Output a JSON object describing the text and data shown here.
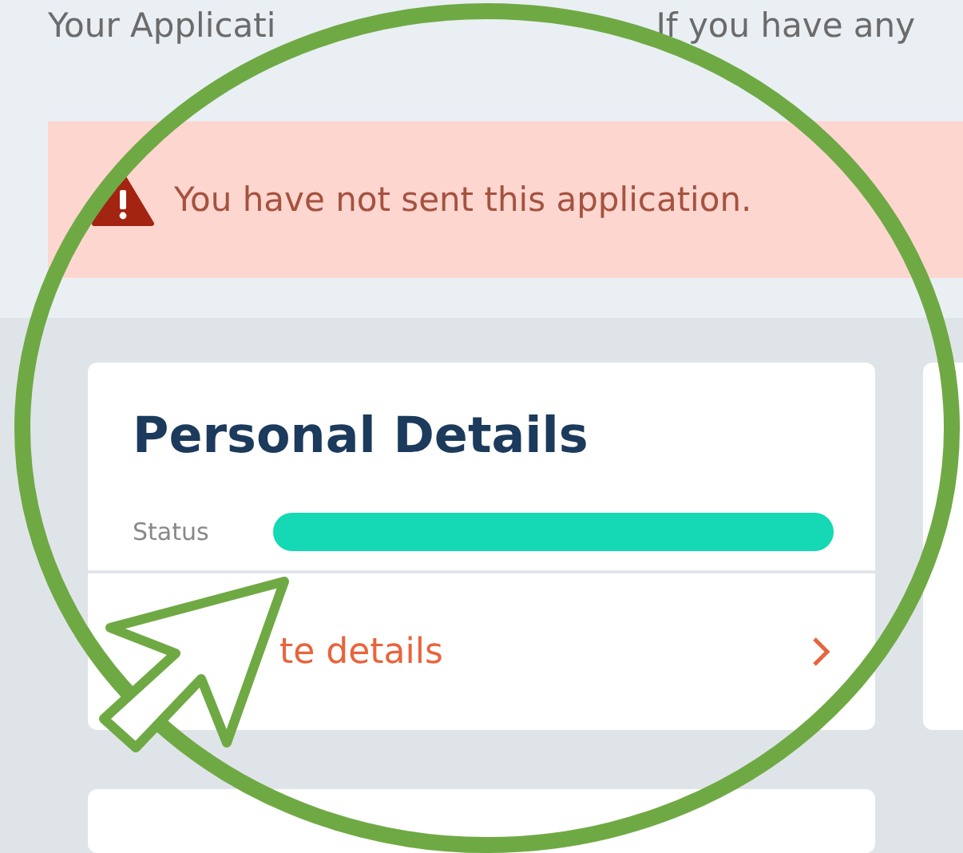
{
  "intro": [
    "Your Applicati",
    "If you have any"
  ],
  "alert": {
    "text": "You have not sent this application."
  },
  "card": {
    "title": "Personal Details",
    "status_label": "Status",
    "level": 1,
    "link": "te details"
  }
}
